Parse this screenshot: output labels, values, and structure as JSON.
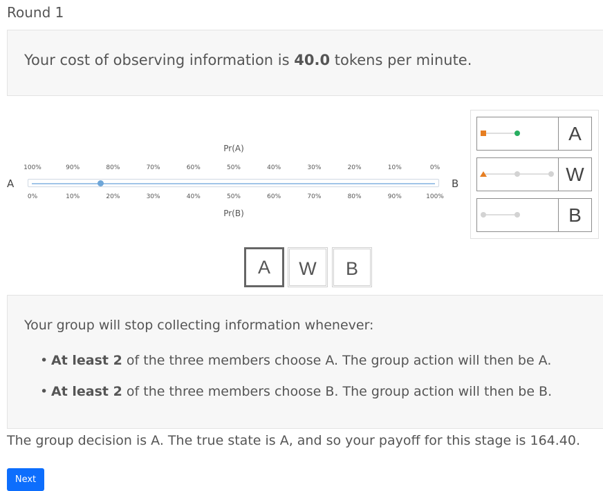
{
  "round_title": "Round 1",
  "cost": {
    "prefix": "Your cost of observing information is ",
    "value": "40.0",
    "suffix": " tokens per minute."
  },
  "slider": {
    "left_label": "A",
    "right_label": "B",
    "top_axis_title": "Pr(A)",
    "bottom_axis_title": "Pr(B)",
    "top_ticks": [
      "100%",
      "90%",
      "80%",
      "70%",
      "60%",
      "50%",
      "40%",
      "30%",
      "20%",
      "10%",
      "0%"
    ],
    "bottom_ticks": [
      "0%",
      "10%",
      "20%",
      "30%",
      "40%",
      "50%",
      "60%",
      "70%",
      "80%",
      "90%",
      "100%"
    ],
    "value_pr_a_percent": 83
  },
  "legend": {
    "rows": [
      {
        "letter": "A",
        "marker": "orange-square",
        "dot": "green-dot"
      },
      {
        "letter": "W",
        "marker": "orange-triangle",
        "dot": "gray-dot"
      },
      {
        "letter": "B",
        "marker": "gray-dot",
        "dot": "gray-dot"
      }
    ],
    "colors": {
      "orange": "#e67e22",
      "green": "#27ae60",
      "gray": "#d3d3d3"
    }
  },
  "choices": [
    {
      "label": "A",
      "selected": true
    },
    {
      "label": "W",
      "selected": false
    },
    {
      "label": "B",
      "selected": false
    }
  ],
  "rules": {
    "header": "Your group will stop collecting information whenever:",
    "items": [
      {
        "bold": "At least 2",
        "text": " of the three members choose A. The group action will then be A."
      },
      {
        "bold": "At least 2",
        "text": " of the three members choose B. The group action will then be B."
      }
    ]
  },
  "decision_text": "The group decision is A. The true state is A, and so your payoff for this stage is 164.40.",
  "next_label": "Next",
  "colors": {
    "primary": "#0d6efd",
    "slider_knob": "#6ea6d8"
  }
}
